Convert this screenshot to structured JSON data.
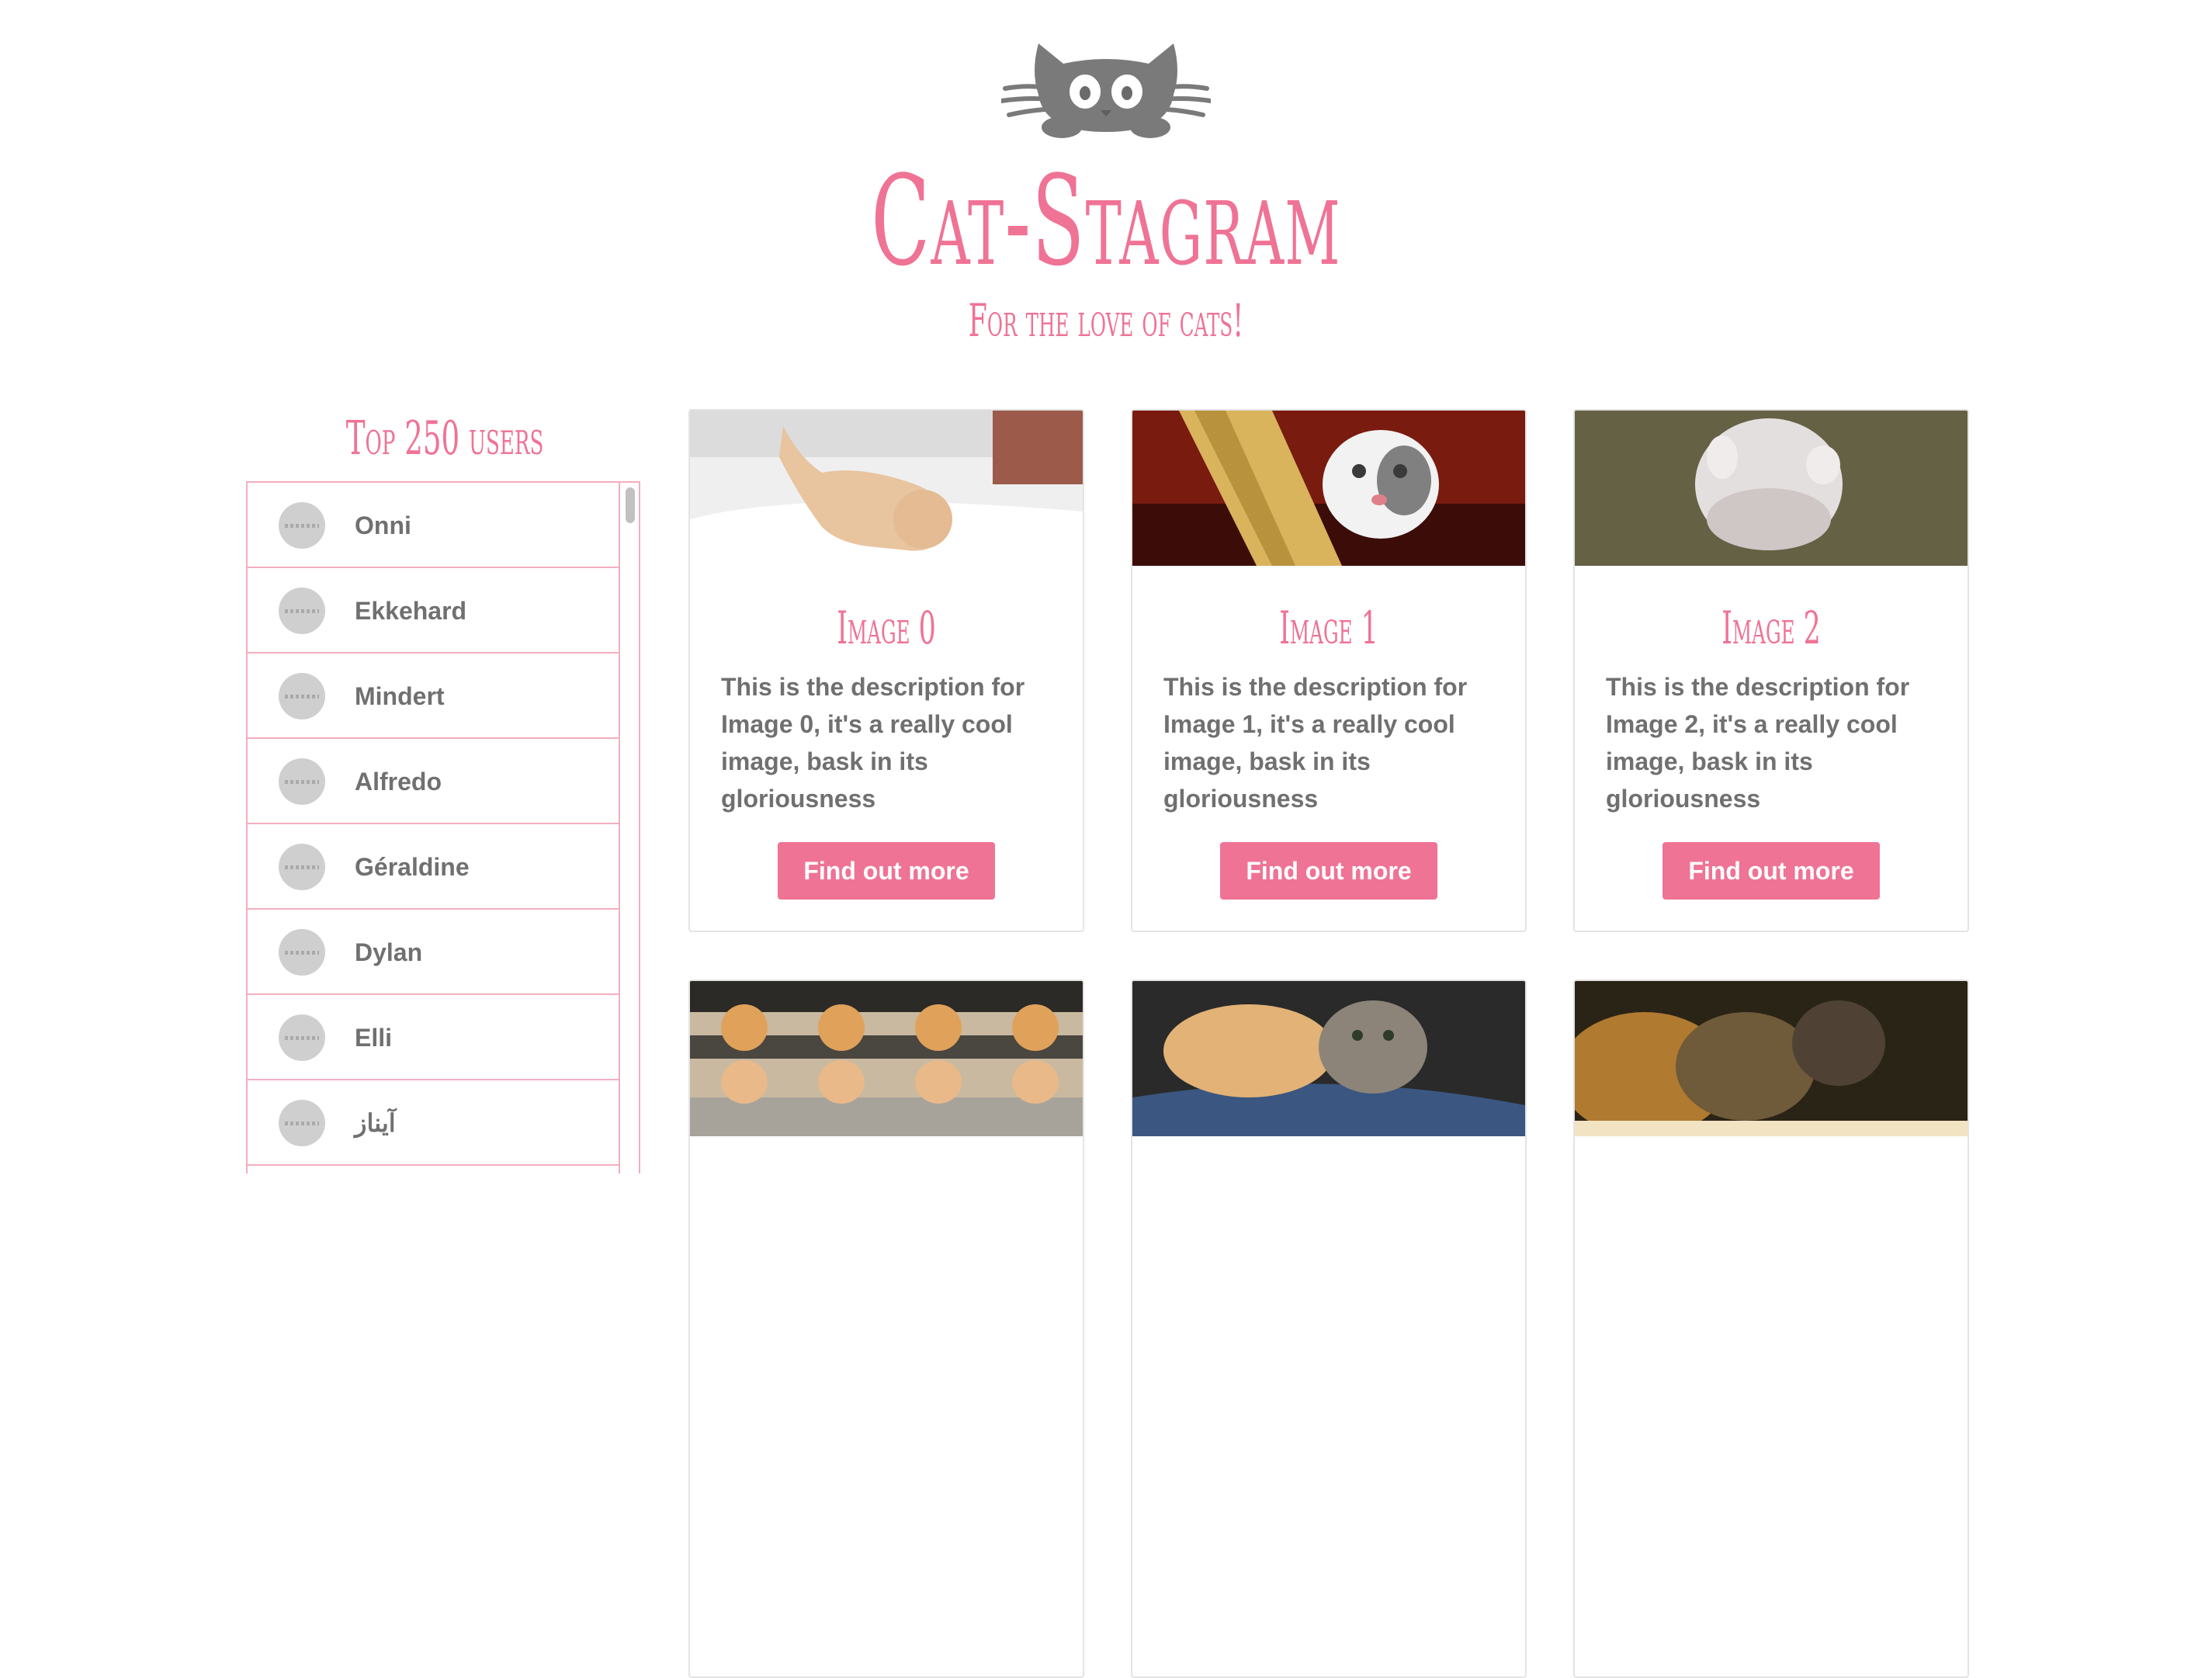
{
  "site": {
    "title": "Cat-Stagram",
    "subtitle": "For the love of cats!",
    "logo_icon": "cat-face-icon",
    "accent_color": "#ef7395",
    "border_color": "#f3aebf",
    "text_color": "#707070"
  },
  "sidebar": {
    "title": "Top 250 users",
    "users": [
      {
        "name": "Onni"
      },
      {
        "name": "Ekkehard"
      },
      {
        "name": "Mindert"
      },
      {
        "name": "Alfredo"
      },
      {
        "name": "Géraldine"
      },
      {
        "name": "Dylan"
      },
      {
        "name": "Elli"
      },
      {
        "name": "آيناز"
      }
    ]
  },
  "cards": [
    {
      "title": "Image 0",
      "description": "This is the description for Image 0, it's a really cool image, bask in its gloriousness",
      "button": "Find out more"
    },
    {
      "title": "Image 1",
      "description": "This is the description for Image 1, it's a really cool image, bask in its gloriousness",
      "button": "Find out more"
    },
    {
      "title": "Image 2",
      "description": "This is the description for Image 2, it's a really cool image, bask in its gloriousness",
      "button": "Find out more"
    },
    {
      "title": "",
      "description": "",
      "button": ""
    },
    {
      "title": "",
      "description": "",
      "button": ""
    },
    {
      "title": "",
      "description": "",
      "button": ""
    }
  ]
}
